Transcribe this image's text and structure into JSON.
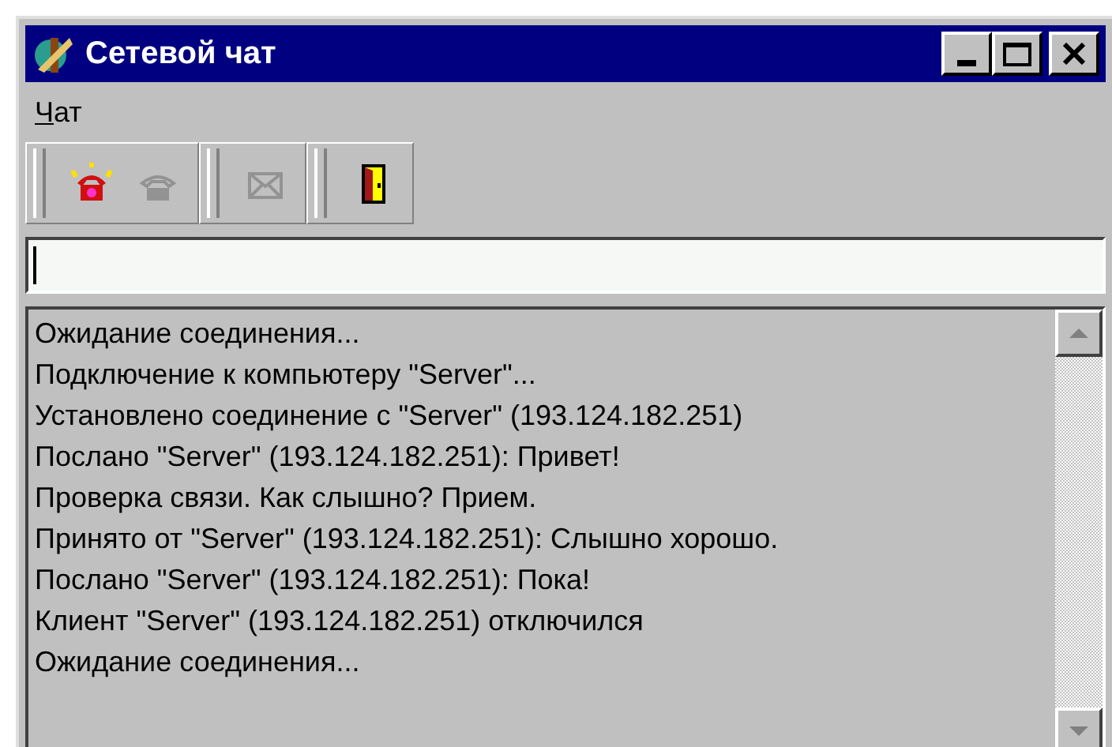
{
  "window": {
    "title": "Сетевой чат"
  },
  "menu": [
    {
      "label": "Чат"
    }
  ],
  "toolbar": [
    {
      "buttons": [
        {
          "kind": "ringing-phone",
          "disabled": false
        },
        {
          "kind": "phone",
          "disabled": true
        }
      ]
    },
    {
      "buttons": [
        {
          "kind": "envelope",
          "disabled": true
        }
      ]
    },
    {
      "buttons": [
        {
          "kind": "door",
          "disabled": false
        }
      ]
    }
  ],
  "log": [
    "Ожидание соединения...",
    "Подключение к компьютеру \"Server\"...",
    "Установлено соединение с \"Server\" (193.124.182.251)",
    "Послано \"Server\" (193.124.182.251): Привет!",
    "Проверка связи. Как слышно? Прием.",
    "Принято от \"Server\" (193.124.182.251): Слышно хорошо.",
    "Послано \"Server\" (193.124.182.251): Пока!",
    "Клиент \"Server\" (193.124.182.251) отключился",
    "Ожидание соединения..."
  ]
}
